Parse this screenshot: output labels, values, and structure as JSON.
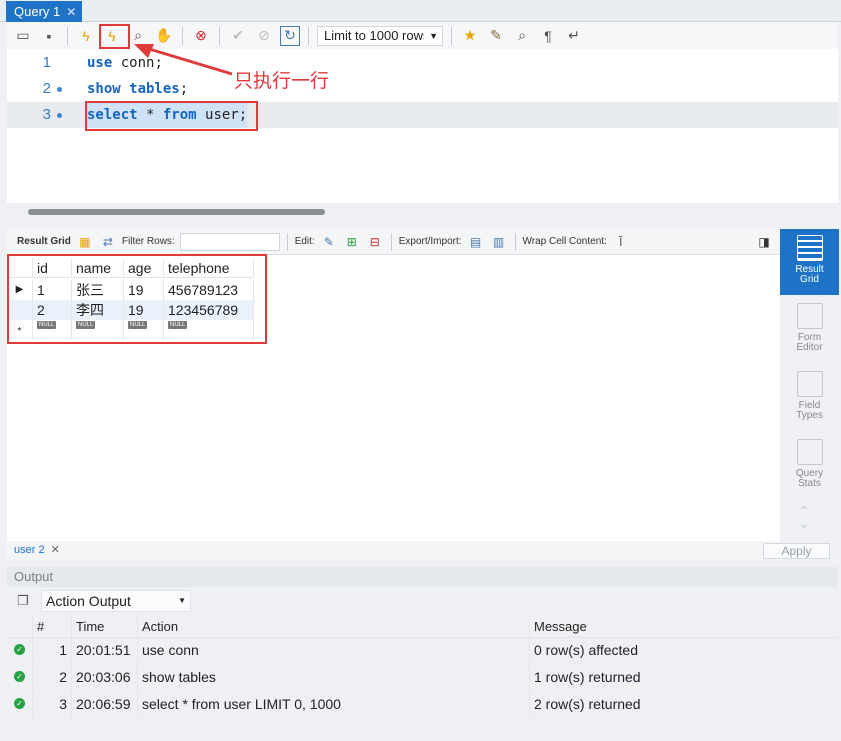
{
  "tab": {
    "title": "Query 1",
    "close": "✕"
  },
  "toolbar": {
    "limit_value": "Limit to 1000 rows",
    "icons": [
      "folder-icon",
      "save-icon",
      "execute-icon",
      "execute-current-icon",
      "explain-icon",
      "stop-icon",
      "toggle-error-icon",
      "commit-icon",
      "rollback-icon",
      "autocommit-icon",
      "bookmark-icon",
      "beautify-icon",
      "find-icon",
      "invisible-chars-icon",
      "wrap-icon"
    ]
  },
  "editor": {
    "lines": [
      {
        "num": "1",
        "keyword": "use",
        "rest": " conn;"
      },
      {
        "num": "2",
        "keyword": "show tables",
        "rest": ";"
      },
      {
        "num": "3",
        "keyword": "select",
        "mid": " * ",
        "keyword2": "from",
        "rest": " user;"
      }
    ],
    "annotation": "只执行一行"
  },
  "result_toolbar": {
    "result_grid": "Result Grid",
    "filter_rows": "Filter Rows:",
    "edit": "Edit:",
    "export_import": "Export/Import:",
    "wrap_cell": "Wrap Cell Content:"
  },
  "grid": {
    "columns": [
      "id",
      "name",
      "age",
      "telephone"
    ],
    "rows": [
      [
        "1",
        "张三",
        "19",
        "456789123"
      ],
      [
        "2",
        "李四",
        "19",
        "123456789"
      ]
    ],
    "null_label": "NULL",
    "new_row_marker": "*"
  },
  "side_panel": [
    {
      "label1": "Result",
      "label2": "Grid"
    },
    {
      "label1": "Form",
      "label2": "Editor"
    },
    {
      "label1": "Field",
      "label2": "Types"
    },
    {
      "label1": "Query",
      "label2": "Stats"
    }
  ],
  "result_tabs": {
    "tab": "user 2",
    "close": "✕",
    "apply": "Apply"
  },
  "output": {
    "header": "Output",
    "selector": "Action Output",
    "columns": [
      "#",
      "Time",
      "Action",
      "Message"
    ],
    "rows": [
      {
        "n": "1",
        "time": "20:01:51",
        "action": "use conn",
        "message": "0 row(s) affected"
      },
      {
        "n": "2",
        "time": "20:03:06",
        "action": "show tables",
        "message": "1 row(s) returned"
      },
      {
        "n": "3",
        "time": "20:06:59",
        "action": "select * from user LIMIT 0, 1000",
        "message": "2 row(s) returned"
      }
    ]
  },
  "colors": {
    "accent": "#1e73c7",
    "annotation": "#e03a3a",
    "success": "#25a244"
  }
}
